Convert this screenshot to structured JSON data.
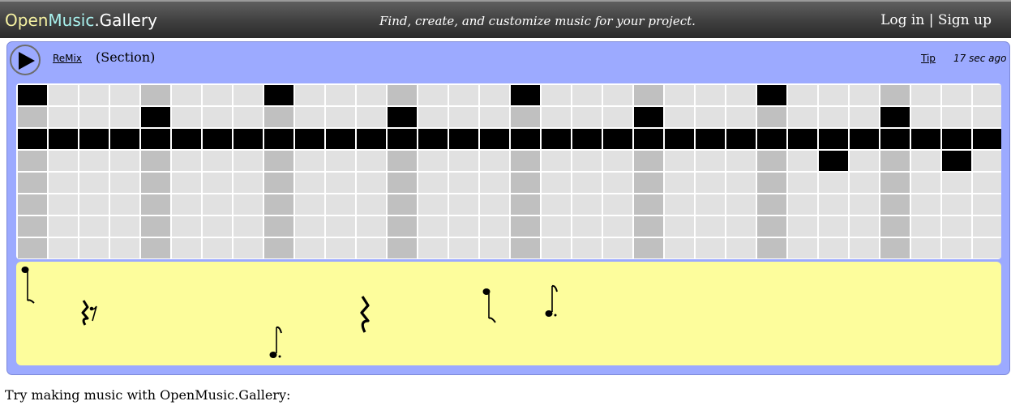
{
  "header": {
    "brand_part1": "Open",
    "brand_part2": "Music",
    "brand_part3": ".Gallery",
    "tagline": "Find, create, and customize music for your project.",
    "login": "Log in",
    "separator": " | ",
    "signup": "Sign up"
  },
  "panel": {
    "remix_label": "ReMix",
    "section_label": "(Section)",
    "tip_label": "Tip",
    "timestamp": "17 sec ago"
  },
  "beat_grid": {
    "rows": 8,
    "columns": 32,
    "beat_every": 4,
    "colors": {
      "empty": "#e1e1e1",
      "beat_marker": "#c0c0c0",
      "active": "#000000"
    },
    "active_cells": [
      [
        0,
        0
      ],
      [
        0,
        8
      ],
      [
        0,
        16
      ],
      [
        0,
        24
      ],
      [
        1,
        4
      ],
      [
        1,
        12
      ],
      [
        1,
        20
      ],
      [
        1,
        28
      ],
      [
        2,
        0
      ],
      [
        2,
        1
      ],
      [
        2,
        2
      ],
      [
        2,
        3
      ],
      [
        2,
        4
      ],
      [
        2,
        5
      ],
      [
        2,
        6
      ],
      [
        2,
        7
      ],
      [
        2,
        8
      ],
      [
        2,
        9
      ],
      [
        2,
        10
      ],
      [
        2,
        11
      ],
      [
        2,
        12
      ],
      [
        2,
        13
      ],
      [
        2,
        14
      ],
      [
        2,
        15
      ],
      [
        2,
        16
      ],
      [
        2,
        17
      ],
      [
        2,
        18
      ],
      [
        2,
        19
      ],
      [
        2,
        20
      ],
      [
        2,
        21
      ],
      [
        2,
        22
      ],
      [
        2,
        23
      ],
      [
        2,
        24
      ],
      [
        2,
        25
      ],
      [
        2,
        26
      ],
      [
        2,
        27
      ],
      [
        2,
        28
      ],
      [
        2,
        29
      ],
      [
        2,
        30
      ],
      [
        2,
        31
      ],
      [
        3,
        26
      ],
      [
        3,
        30
      ]
    ]
  },
  "notation": {
    "symbols": [
      "eighth-note",
      "quarter-and-eighth-rest",
      "eighth-note-dotted",
      "quarter-rest",
      "eighth-note",
      "eighth-note-dotted"
    ]
  },
  "footer": {
    "prompt": "Try making music with OpenMusic.Gallery:"
  }
}
